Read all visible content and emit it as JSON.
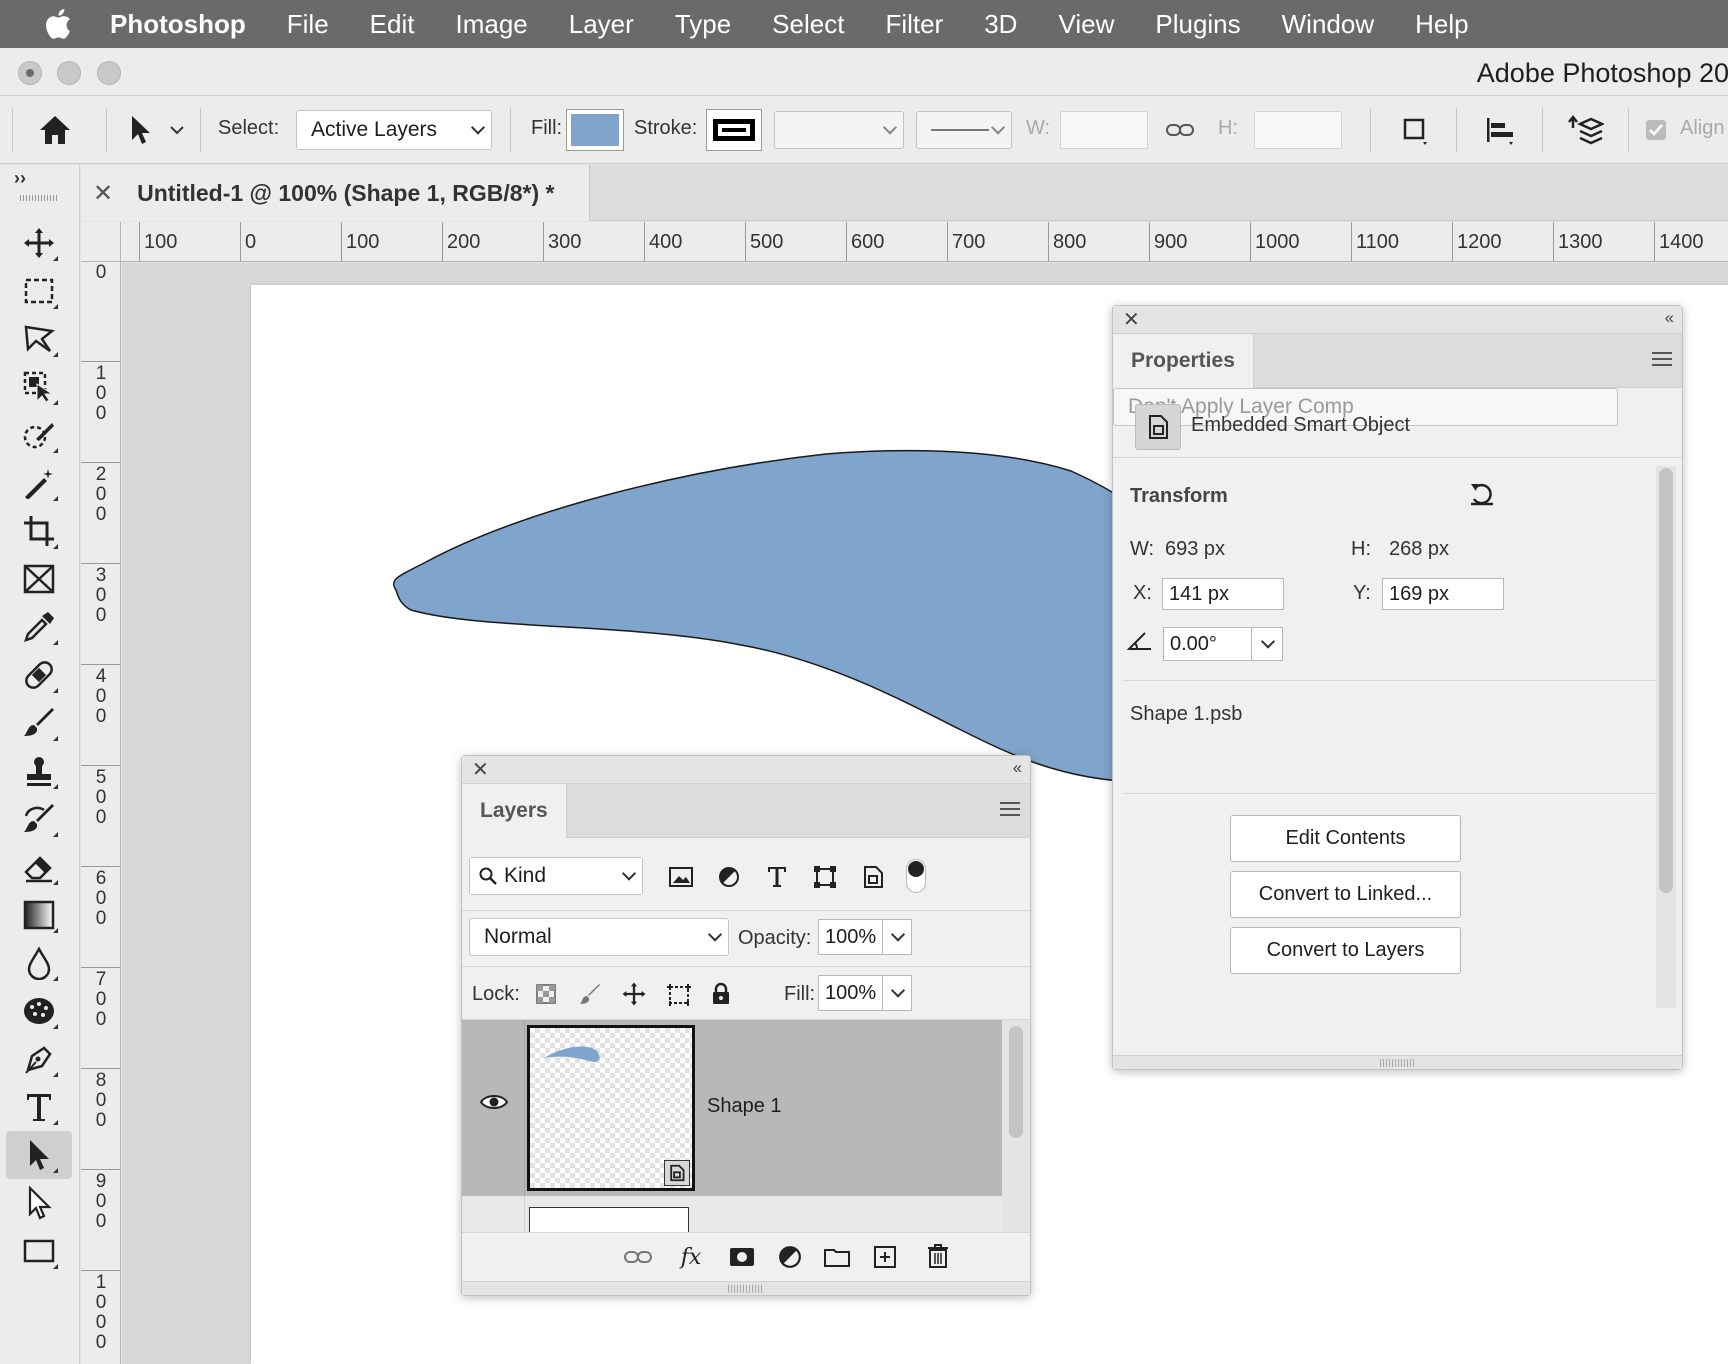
{
  "menubar": {
    "app_name": "Photoshop",
    "items": [
      "File",
      "Edit",
      "Image",
      "Layer",
      "Type",
      "Select",
      "Filter",
      "3D",
      "View",
      "Plugins",
      "Window",
      "Help"
    ]
  },
  "window": {
    "title": "Adobe Photoshop 20"
  },
  "options_bar": {
    "select_label": "Select:",
    "select_value": "Active Layers",
    "fill_label": "Fill:",
    "fill_color": "#7fa5cc",
    "stroke_label": "Stroke:",
    "w_label": "W:",
    "h_label": "H:",
    "align_label": "Align"
  },
  "document_tab": {
    "title": "Untitled-1 @ 100% (Shape 1, RGB/8*) *"
  },
  "rulers": {
    "horizontal": [
      "100",
      "0",
      "100",
      "200",
      "300",
      "400",
      "500",
      "600",
      "700",
      "800",
      "900",
      "1000",
      "1100",
      "1200",
      "1300",
      "1400"
    ],
    "vertical": [
      "0",
      "100",
      "200",
      "300",
      "400",
      "500",
      "600",
      "700",
      "800",
      "900",
      "1000"
    ]
  },
  "shape": {
    "fill": "#7fa5cc",
    "stroke": "#1a1a1a"
  },
  "properties_panel": {
    "tab": "Properties",
    "object_type": "Embedded Smart Object",
    "transform_heading": "Transform",
    "w_label": "W:",
    "w_value": "693 px",
    "h_label": "H:",
    "h_value": "268 px",
    "x_label": "X:",
    "x_value": "141 px",
    "y_label": "Y:",
    "y_value": "169 px",
    "angle_value": "0.00°",
    "file_name": "Shape 1.psb",
    "layer_comp": "Don't Apply Layer Comp",
    "buttons": [
      "Edit Contents",
      "Convert to Linked...",
      "Convert to Layers"
    ]
  },
  "layers_panel": {
    "tab": "Layers",
    "filter_kind": "Kind",
    "blend_mode": "Normal",
    "opacity_label": "Opacity:",
    "opacity_value": "100%",
    "lock_label": "Lock:",
    "fill_label": "Fill:",
    "fill_value": "100%",
    "layers": [
      {
        "name": "Shape 1",
        "visible": true,
        "selected": true
      }
    ]
  }
}
